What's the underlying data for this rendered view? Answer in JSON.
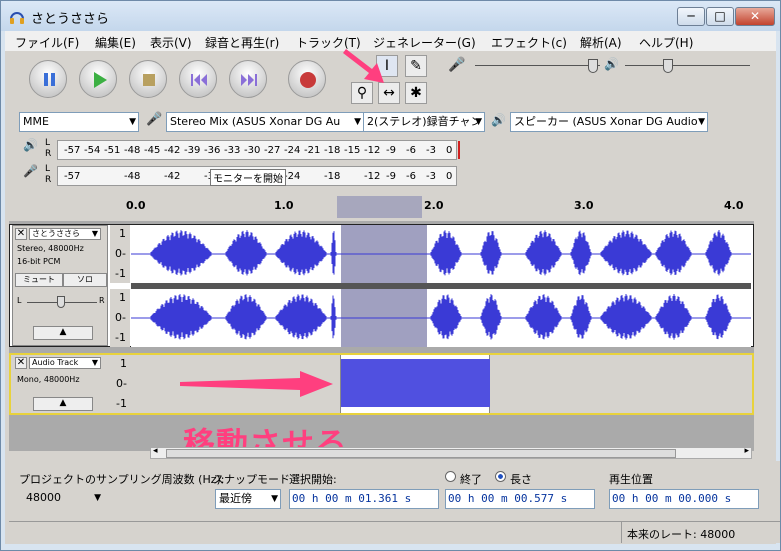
{
  "window": {
    "title": "さとうささら",
    "min": "─",
    "max": "□",
    "close": "✕"
  },
  "menu": [
    "ファイル(F)",
    "編集(E)",
    "表示(V)",
    "録音と再生(r)",
    "トラック(T)",
    "ジェネレーター(G)",
    "エフェクト(c)",
    "解析(A)",
    "ヘルプ(H)"
  ],
  "colors": {
    "accent": "#ff3f7f",
    "wave": "#3a3ad6",
    "selection": "#a0a0c0"
  },
  "toolbar": {
    "play_icon": "play-icon",
    "pause_icon": "pause-icon",
    "stop_icon": "stop-icon",
    "skip_start_icon": "skip-start-icon",
    "skip_end_icon": "skip-end-icon",
    "record_icon": "record-icon"
  },
  "device": {
    "host": "MME",
    "input": "Stereo Mix (ASUS Xonar DG Au",
    "channels": "2(ステレオ)録音チャン",
    "output": "スピーカー (ASUS Xonar DG Audio"
  },
  "meters": {
    "ticks": [
      "-57",
      "-54",
      "-51",
      "-48",
      "-45",
      "-42",
      "-39",
      "-36",
      "-33",
      "-30",
      "-27",
      "-24",
      "-21",
      "-18",
      "-15",
      "-12",
      "-9",
      "-6",
      "-3",
      "0"
    ],
    "rec_ticks": [
      "-57",
      "-48",
      "-42",
      "-3",
      "-24",
      "-18",
      "-12",
      "-9",
      "-6",
      "-3",
      "0"
    ],
    "monitor_label": "モニターを開始",
    "play_L": "L",
    "play_R": "R",
    "rec_L": "L",
    "rec_R": "R"
  },
  "ruler": {
    "labels": [
      "0.0",
      "1.0",
      "2.0",
      "3.0",
      "4.0"
    ]
  },
  "track1": {
    "name": "さとうささら",
    "info1": "Stereo, 48000Hz",
    "info2": "16-bit PCM",
    "mute": "ミュート",
    "solo": "ソロ",
    "scale": [
      "1",
      "0-",
      "-1"
    ],
    "scale2": [
      "1",
      "0-",
      "-1"
    ],
    "pan_l": "L",
    "pan_r": "R"
  },
  "track2": {
    "name": "Audio Track",
    "info1": "Mono, 48000Hz",
    "scale": [
      "1",
      "0-",
      "-1"
    ]
  },
  "annotation": "移動させる",
  "bottom": {
    "rate_label": "プロジェクトのサンプリング周波数 (Hz):",
    "rate_value": "48000",
    "snap_label": "スナップモード",
    "snap_value": "最近傍",
    "sel_start_label": "選択開始:",
    "end_label": "終了",
    "length_label": "長さ",
    "pos_label": "再生位置",
    "sel_start": "00 h 00 m 01.361 s",
    "length": "00 h 00 m 00.577 s",
    "pos": "00 h 00 m 00.000 s"
  },
  "status": {
    "rate": "本来のレート: 48000"
  }
}
